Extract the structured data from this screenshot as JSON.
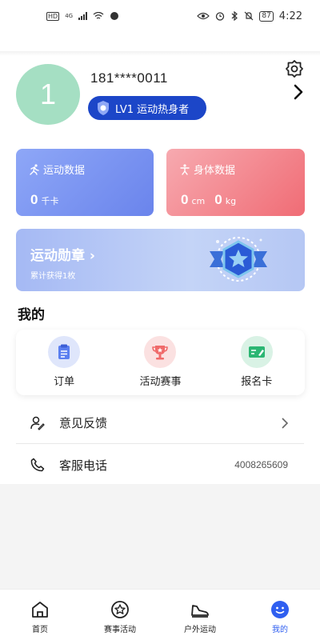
{
  "status_bar": {
    "time": "4:22",
    "battery": "87",
    "network": "4G"
  },
  "profile": {
    "avatar_text": "1",
    "phone": "181****0011",
    "level_label": "LV1 运动热身者"
  },
  "cards": {
    "sport": {
      "title": "运动数据",
      "value": "0",
      "unit": "千卡"
    },
    "body": {
      "title": "身体数据",
      "value1": "0",
      "unit1": "cm",
      "value2": "0",
      "unit2": "kg"
    }
  },
  "medal": {
    "title": "运动勋章 ›",
    "subtitle": "累计获得1枚"
  },
  "mine": {
    "title": "我的",
    "items": [
      {
        "label": "订单",
        "icon": "clipboard-icon",
        "color": "#5b7ff0"
      },
      {
        "label": "活动赛事",
        "icon": "trophy-icon",
        "color": "#f06a6a"
      },
      {
        "label": "报名卡",
        "icon": "card-icon",
        "color": "#2bb673"
      }
    ]
  },
  "list": {
    "feedback": {
      "label": "意见反馈"
    },
    "service": {
      "label": "客服电话",
      "value": "4008265609"
    }
  },
  "tabbar": {
    "items": [
      {
        "label": "首页",
        "icon": "home-icon"
      },
      {
        "label": "赛事活动",
        "icon": "star-medal-icon"
      },
      {
        "label": "户外运动",
        "icon": "shoe-icon"
      },
      {
        "label": "我的",
        "icon": "smiley-icon",
        "active": true
      }
    ]
  },
  "colors": {
    "accent": "#2f5ff0",
    "badge": "#1c46c8"
  }
}
